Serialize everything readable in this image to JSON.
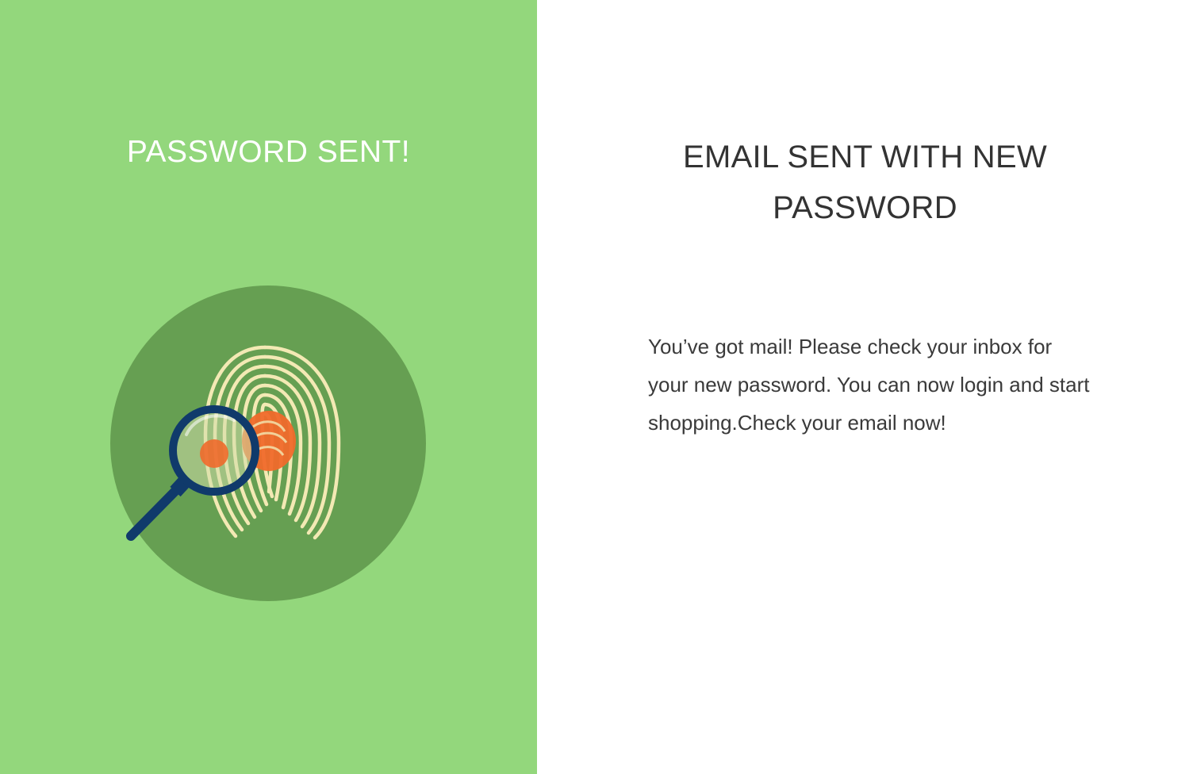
{
  "colors": {
    "panel_green": "#93d77c",
    "circle_green": "#669f52",
    "fingerprint_cream": "#f3e9b4",
    "fingerprint_orange": "#f06a2b",
    "magnifier_navy": "#103a6b"
  },
  "left_panel": {
    "title": "PASSWORD SENT!",
    "illustration_icon": "fingerprint-magnifier-icon"
  },
  "right_panel": {
    "title": "EMAIL SENT WITH NEW PASSWORD",
    "message": "You’ve got mail! Please check your inbox for your new password. You can now login and start shopping.Check your email now!"
  }
}
